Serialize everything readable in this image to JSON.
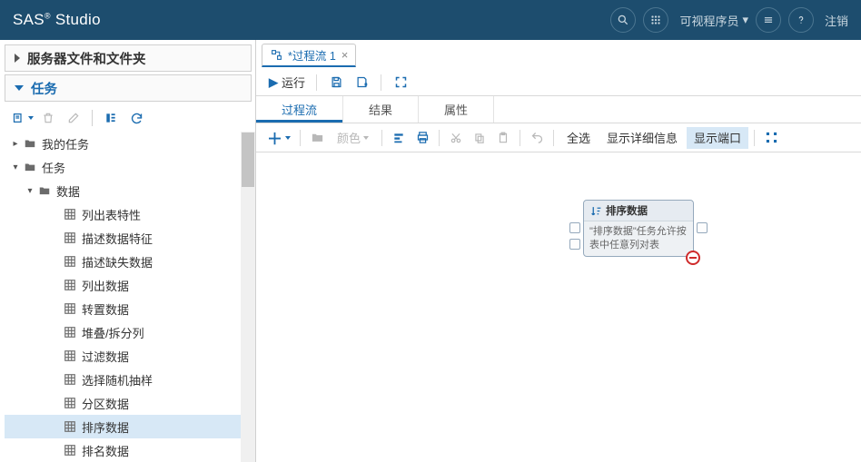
{
  "header": {
    "logo_pre": "SAS",
    "logo_post": " Studio",
    "role": "可视程序员",
    "signout": "注销"
  },
  "sidebar": {
    "section_files": "服务器文件和文件夹",
    "section_tasks": "任务",
    "tree": {
      "my_tasks": "我的任务",
      "tasks": "任务",
      "data": "数据",
      "items": [
        "列出表特性",
        "描述数据特征",
        "描述缺失数据",
        "列出数据",
        "转置数据",
        "堆叠/拆分列",
        "过滤数据",
        "选择随机抽样",
        "分区数据",
        "排序数据",
        "排名数据"
      ],
      "selected_index": 9
    }
  },
  "content": {
    "tab_label": "*过程流 1",
    "run": "运行",
    "subtabs": {
      "flow": "过程流",
      "results": "结果",
      "props": "属性"
    },
    "actbar": {
      "color": "颜色",
      "select_all": "全选",
      "details": "显示详细信息",
      "ports": "显示端口"
    },
    "node": {
      "title": "排序数据",
      "desc": "\"排序数据\"任务允许按表中任意列对表"
    }
  }
}
